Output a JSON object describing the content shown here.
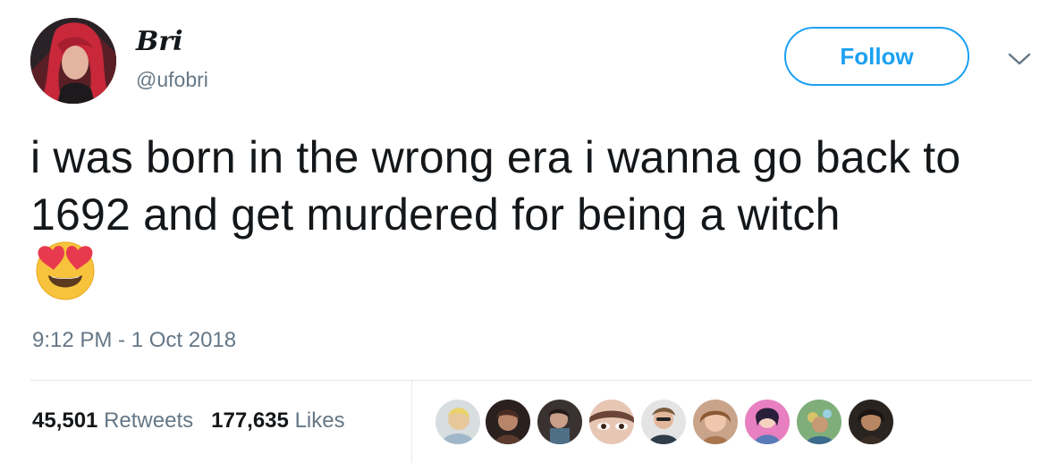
{
  "user": {
    "display_name": "Bri",
    "handle": "@ufobri",
    "avatar_icon": "profile-photo"
  },
  "actions": {
    "follow_label": "Follow",
    "menu_icon": "chevron-down-icon"
  },
  "tweet": {
    "text": "i was born in the wrong era i wanna go back to 1692 and get murdered for being a witch",
    "emoji": "smiling-face-with-heart-eyes",
    "timestamp": "9:12 PM - 1 Oct 2018"
  },
  "stats": {
    "retweets_count": "45,501",
    "retweets_label": "Retweets",
    "likes_count": "177,635",
    "likes_label": "Likes"
  },
  "likers": [
    {
      "name": "liker-avatar-1"
    },
    {
      "name": "liker-avatar-2"
    },
    {
      "name": "liker-avatar-3"
    },
    {
      "name": "liker-avatar-4"
    },
    {
      "name": "liker-avatar-5"
    },
    {
      "name": "liker-avatar-6"
    },
    {
      "name": "liker-avatar-7"
    },
    {
      "name": "liker-avatar-8"
    },
    {
      "name": "liker-avatar-9"
    }
  ],
  "colors": {
    "accent": "#1da1f2",
    "secondary_text": "#657786",
    "primary_text": "#14171a",
    "divider": "#e1e8ed"
  }
}
